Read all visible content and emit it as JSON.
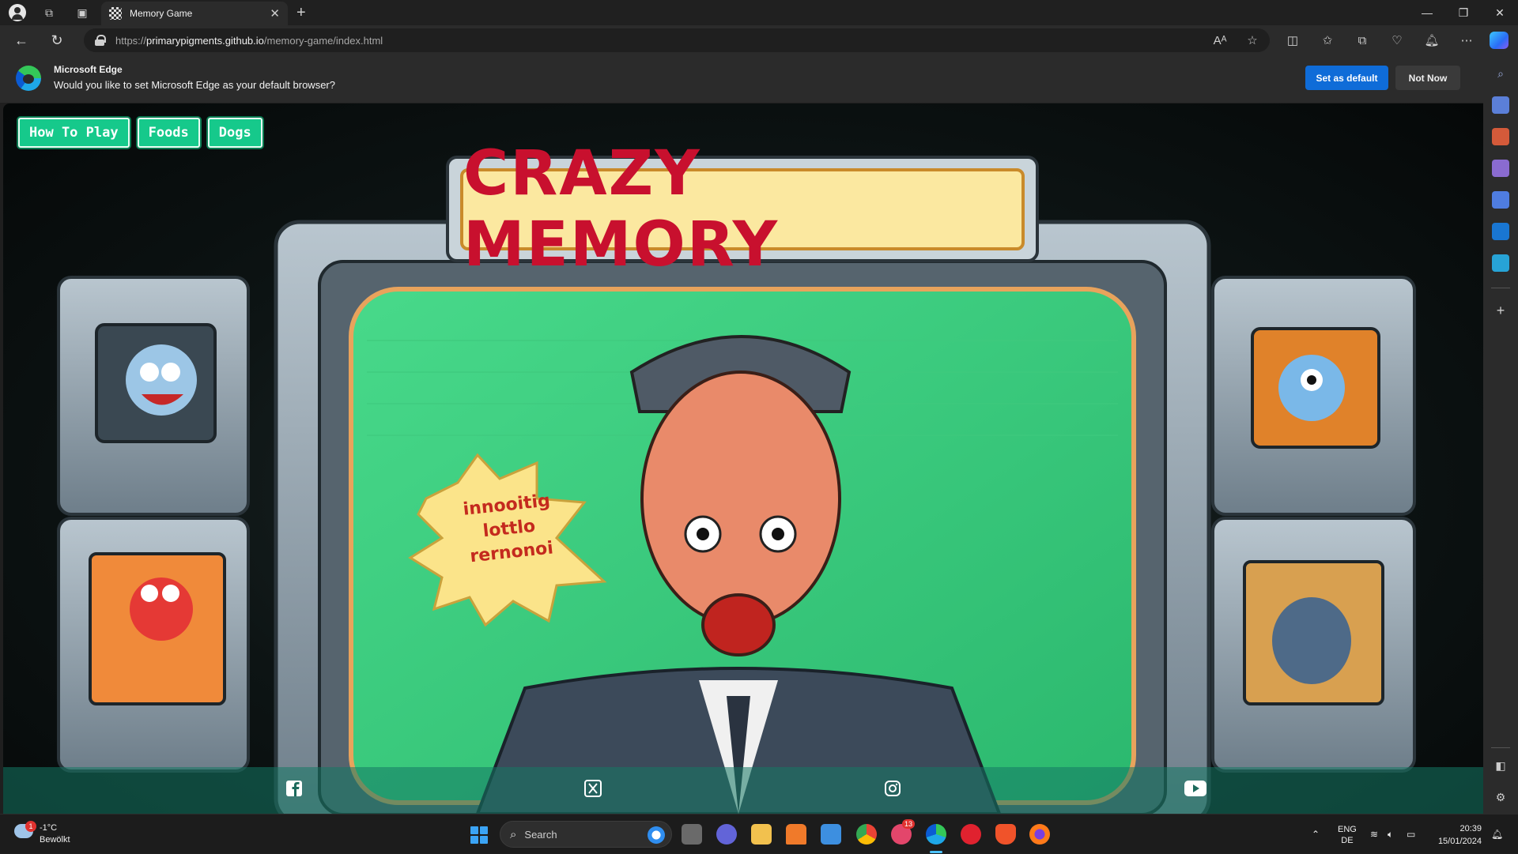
{
  "browser": {
    "tab_title": "Memory Game",
    "url_prefix": "https://",
    "url_host": "primarypigments.github.io",
    "url_path": "/memory-game/index.html"
  },
  "notice": {
    "title": "Microsoft Edge",
    "message": "Would you like to set Microsoft Edge as your default browser?",
    "primary_label": "Set as default",
    "secondary_label": "Not Now"
  },
  "game": {
    "nav": [
      "How To Play",
      "Foods",
      "Dogs"
    ],
    "sign_text": "CRAZY MEMORY",
    "bubble_lines": [
      "innooitig",
      "lottlo",
      "rernonoi"
    ],
    "social_icons": [
      "facebook-icon",
      "x-icon",
      "instagram-icon",
      "youtube-icon"
    ]
  },
  "taskbar": {
    "weather_badge": "1",
    "temperature": "-1°C",
    "condition": "Bewölkt",
    "search_placeholder": "Search",
    "badge_count": "13",
    "lang_top": "ENG",
    "lang_bottom": "DE",
    "time": "20:39",
    "date": "15/01/2024"
  },
  "colors": {
    "accent_button": "#16c98b",
    "edge_blue": "#0f6cd8",
    "sign_red": "#c8102e"
  }
}
